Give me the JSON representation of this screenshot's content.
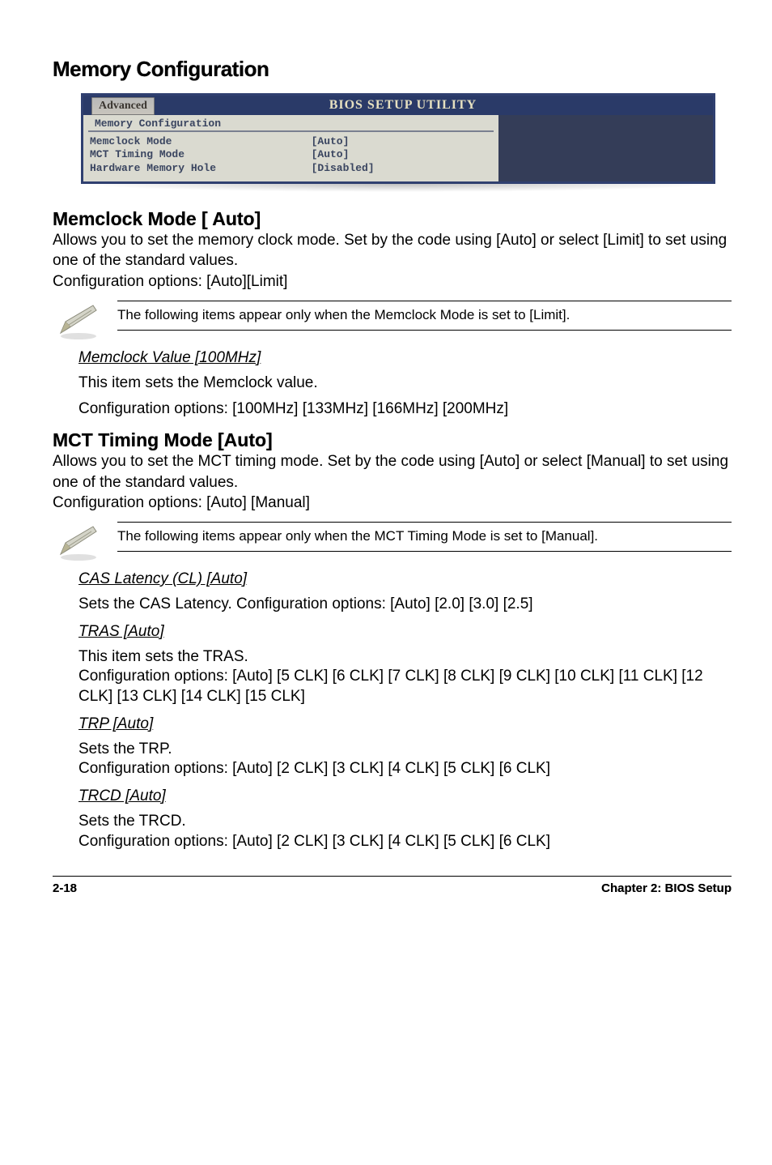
{
  "heading": "Memory Configuration",
  "bios": {
    "tab": "Advanced",
    "title": "BIOS SETUP UTILITY",
    "panel_title": "Memory Configuration",
    "rows": [
      {
        "key": "Memclock Mode",
        "val": "[Auto]"
      },
      {
        "key": "MCT Timing Mode",
        "val": "[Auto]"
      },
      {
        "key": "Hardware Memory Hole",
        "val": "[Disabled]"
      }
    ]
  },
  "memclock_mode": {
    "title": "Memclock Mode [ Auto]",
    "body": "Allows you to set the memory clock mode. Set by the code using [Auto] or select [Limit] to set using one of the standard values.\nConfiguration options: [Auto][Limit]",
    "note": "The following items appear only when the Memclock Mode is set to [Limit].",
    "memclock_value": {
      "title": "Memclock Value [100MHz]",
      "line1": "This item sets the Memclock value.",
      "line2": "Configuration options: [100MHz] [133MHz] [166MHz] [200MHz]"
    }
  },
  "mct": {
    "title": "MCT Timing Mode [Auto]",
    "body": "Allows you to set the MCT timing mode. Set by the code using [Auto] or select [Manual] to set using one of the standard values.\nConfiguration options: [Auto] [Manual]",
    "note": "The following items appear only when the MCT Timing Mode is set to [Manual].",
    "cas": {
      "title": "CAS Latency (CL) [Auto]",
      "line": "Sets the CAS Latency. Configuration options: [Auto] [2.0] [3.0] [2.5]"
    },
    "tras": {
      "title": "TRAS [Auto]",
      "line": "This item sets the TRAS.\nConfiguration options: [Auto] [5 CLK] [6 CLK] [7 CLK] [8 CLK] [9 CLK] [10 CLK] [11 CLK] [12 CLK] [13 CLK] [14 CLK] [15 CLK]"
    },
    "trp": {
      "title": "TRP [Auto]",
      "line": "Sets the TRP.\nConfiguration options: [Auto] [2 CLK] [3 CLK] [4 CLK] [5 CLK] [6 CLK]"
    },
    "trcd": {
      "title": "TRCD [Auto]",
      "line": "Sets the TRCD.\nConfiguration options: [Auto] [2 CLK] [3 CLK] [4 CLK] [5 CLK] [6 CLK]"
    }
  },
  "footer": {
    "left": "2-18",
    "right": "Chapter 2: BIOS Setup"
  }
}
